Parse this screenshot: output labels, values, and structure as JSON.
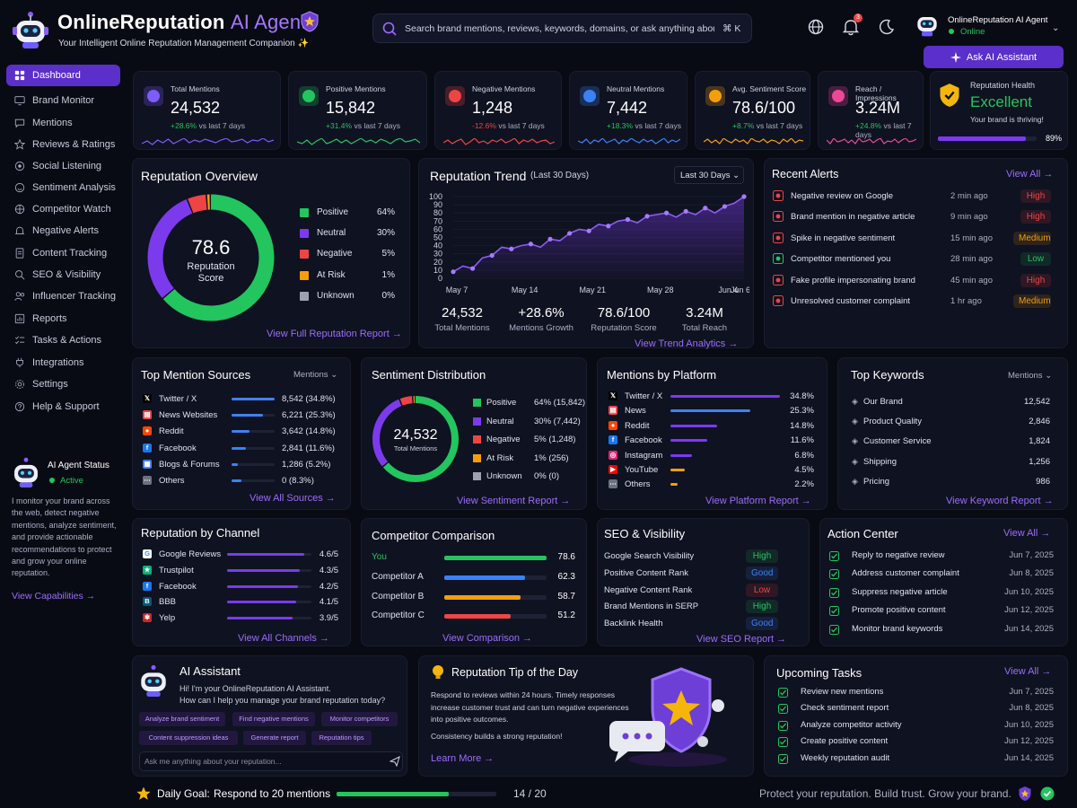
{
  "app": {
    "name": "OnlineReputation",
    "name_accent": "AI Agent",
    "subtitle": "Your Intelligent Online Reputation Management Companion ✨"
  },
  "search": {
    "placeholder": "Search brand mentions, reviews, keywords, domains, or ask anything about...",
    "shortcut": "⌘ K"
  },
  "header": {
    "notification_count": "3",
    "user_name": "OnlineReputation AI Agent",
    "user_status": "Online",
    "ask_button": "Ask AI Assistant"
  },
  "sidebar": {
    "items": [
      {
        "label": "Dashboard",
        "icon": "home-icon"
      },
      {
        "label": "Brand Monitor",
        "icon": "monitor-icon"
      },
      {
        "label": "Mentions",
        "icon": "chat-icon"
      },
      {
        "label": "Reviews & Ratings",
        "icon": "star-icon"
      },
      {
        "label": "Social Listening",
        "icon": "listen-icon"
      },
      {
        "label": "Sentiment Analysis",
        "icon": "sentiment-icon"
      },
      {
        "label": "Competitor Watch",
        "icon": "competitor-icon"
      },
      {
        "label": "Negative Alerts",
        "icon": "bell-icon"
      },
      {
        "label": "Content Tracking",
        "icon": "document-icon"
      },
      {
        "label": "SEO & Visibility",
        "icon": "seo-icon"
      },
      {
        "label": "Influencer Tracking",
        "icon": "influencer-icon"
      },
      {
        "label": "Reports",
        "icon": "report-icon"
      },
      {
        "label": "Tasks & Actions",
        "icon": "tasks-icon"
      },
      {
        "label": "Integrations",
        "icon": "plug-icon"
      },
      {
        "label": "Settings",
        "icon": "gear-icon"
      },
      {
        "label": "Help & Support",
        "icon": "help-icon"
      }
    ],
    "agent_status": {
      "title": "AI Agent Status",
      "status": "Active",
      "description": "I monitor your brand across the web, detect negative mentions, analyze sentiment, and provide actionable recommendations to protect and grow your online reputation.",
      "link": "View Capabilities →"
    }
  },
  "stats": [
    {
      "label": "Total Mentions",
      "value": "24,532",
      "change": "+28.6%",
      "suffix": "vs last 7 days",
      "color": "#7c5cff",
      "icon": "users-icon"
    },
    {
      "label": "Positive Mentions",
      "value": "15,842",
      "change": "+31.4%",
      "suffix": "vs last 7 days",
      "color": "#22c55e",
      "icon": "rocket-icon"
    },
    {
      "label": "Negative Mentions",
      "value": "1,248",
      "change": "-12.6%",
      "suffix": "vs last 7 days",
      "color": "#ef4444",
      "icon": "alert-shield-icon"
    },
    {
      "label": "Neutral Mentions",
      "value": "7,442",
      "change": "+18.3%",
      "suffix": "vs last 7 days",
      "color": "#3b82f6",
      "icon": "neutral-icon"
    },
    {
      "label": "Avg. Sentiment Score",
      "value": "78.6/100",
      "change": "+8.7%",
      "suffix": "vs last 7 days",
      "color": "#f59e0b",
      "icon": "shield-star-icon"
    },
    {
      "label": "Reach / Impressions",
      "value": "3.24M",
      "change": "+24.8%",
      "suffix": "vs last 7 days",
      "color": "#ec4899",
      "icon": "trend-icon"
    }
  ],
  "health": {
    "label": "Reputation Health",
    "value": "Excellent",
    "note": "Your brand is thriving!",
    "percent_text": "89%",
    "percent": 89
  },
  "overview": {
    "title": "Reputation Overview",
    "score": "78.6",
    "score_label": "Reputation Score",
    "legend": [
      {
        "label": "Positive",
        "value": "64%",
        "color": "#22c55e",
        "pct": 64
      },
      {
        "label": "Neutral",
        "value": "30%",
        "color": "#7c3aed",
        "pct": 30
      },
      {
        "label": "Negative",
        "value": "5%",
        "color": "#ef4444",
        "pct": 5
      },
      {
        "label": "At Risk",
        "value": "1%",
        "color": "#f59e0b",
        "pct": 1
      },
      {
        "label": "Unknown",
        "value": "0%",
        "color": "#9ca3af",
        "pct": 0
      }
    ],
    "link": "View Full Reputation Report →"
  },
  "trend": {
    "title": "Reputation Trend",
    "subtitle": "(Last 30 Days)",
    "range": "Last 30 Days",
    "stats": [
      {
        "value": "24,532",
        "label": "Total Mentions"
      },
      {
        "value": "+28.6%",
        "label": "Mentions Growth"
      },
      {
        "value": "78.6/100",
        "label": "Reputation Score"
      },
      {
        "value": "3.24M",
        "label": "Total Reach"
      }
    ],
    "link": "View Trend Analytics →"
  },
  "chart_data": {
    "type": "area",
    "x": [
      "May 7",
      "May 8",
      "May 9",
      "May 10",
      "May 11",
      "May 12",
      "May 13",
      "May 14",
      "May 15",
      "May 16",
      "May 17",
      "May 18",
      "May 19",
      "May 20",
      "May 21",
      "May 22",
      "May 23",
      "May 24",
      "May 25",
      "May 26",
      "May 27",
      "May 28",
      "May 29",
      "May 30",
      "May 31",
      "Jun 1",
      "Jun 2",
      "Jun 3",
      "Jun 4",
      "Jun 5",
      "Jun 6"
    ],
    "x_ticks": [
      "May 7",
      "May 14",
      "May 21",
      "May 28",
      "Jun 4",
      "Jun 6"
    ],
    "series": [
      {
        "values": [
          8,
          15,
          12,
          25,
          28,
          38,
          36,
          40,
          42,
          38,
          48,
          46,
          55,
          60,
          58,
          66,
          64,
          70,
          72,
          68,
          76,
          78,
          80,
          75,
          82,
          78,
          86,
          80,
          88,
          92,
          100
        ]
      }
    ],
    "ylim": [
      0,
      100
    ],
    "yticks": [
      0,
      10,
      20,
      30,
      40,
      50,
      60,
      70,
      80,
      90,
      100
    ],
    "grid": true
  },
  "alerts": {
    "title": "Recent Alerts",
    "link": "View All →",
    "items": [
      {
        "text": "Negative review on Google",
        "time": "2 min ago",
        "level": "High",
        "color": "#ef4444"
      },
      {
        "text": "Brand mention in negative article",
        "time": "9 min ago",
        "level": "High",
        "color": "#ef4444"
      },
      {
        "text": "Spike in negative sentiment",
        "time": "15 min ago",
        "level": "Medium",
        "color": "#f59e0b"
      },
      {
        "text": "Competitor mentioned you",
        "time": "28 min ago",
        "level": "Low",
        "color": "#22c55e"
      },
      {
        "text": "Fake profile impersonating brand",
        "time": "45 min ago",
        "level": "High",
        "color": "#ef4444"
      },
      {
        "text": "Unresolved customer complaint",
        "time": "1 hr ago",
        "level": "Medium",
        "color": "#f59e0b"
      }
    ]
  },
  "sources": {
    "title": "Top Mention Sources",
    "filter": "Mentions",
    "link": "View All Sources →",
    "items": [
      {
        "name": "Twitter / X",
        "value": "8,542 (34.8%)",
        "pct": 34.8,
        "icon": "twitter-icon"
      },
      {
        "name": "News Websites",
        "value": "6,221 (25.3%)",
        "pct": 25.3,
        "icon": "news-icon"
      },
      {
        "name": "Reddit",
        "value": "3,642 (14.8%)",
        "pct": 14.8,
        "icon": "reddit-icon"
      },
      {
        "name": "Facebook",
        "value": "2,841 (11.6%)",
        "pct": 11.6,
        "icon": "facebook-icon"
      },
      {
        "name": "Blogs & Forums",
        "value": "1,286 (5.2%)",
        "pct": 5.2,
        "icon": "blog-icon"
      },
      {
        "name": "Others",
        "value": "0 (8.3%)",
        "pct": 8.3,
        "icon": "others-icon"
      }
    ]
  },
  "sentiment": {
    "title": "Sentiment Distribution",
    "total": "24,532",
    "total_label": "Total Mentions",
    "link": "View Sentiment Report →",
    "items": [
      {
        "label": "Positive",
        "value": "64% (15,842)",
        "pct": 64,
        "color": "#22c55e"
      },
      {
        "label": "Neutral",
        "value": "30% (7,442)",
        "pct": 30,
        "color": "#7c3aed"
      },
      {
        "label": "Negative",
        "value": "5% (1,248)",
        "pct": 5,
        "color": "#ef4444"
      },
      {
        "label": "At Risk",
        "value": "1% (256)",
        "pct": 1,
        "color": "#f59e0b"
      },
      {
        "label": "Unknown",
        "value": "0% (0)",
        "pct": 0,
        "color": "#9ca3af"
      }
    ]
  },
  "platforms": {
    "title": "Mentions by Platform",
    "link": "View Platform Report →",
    "items": [
      {
        "name": "Twitter / X",
        "value": "34.8%",
        "pct": 34.8,
        "color": "#7c3aed",
        "icon": "twitter-icon"
      },
      {
        "name": "News",
        "value": "25.3%",
        "pct": 25.3,
        "color": "#3b82f6",
        "icon": "news-icon"
      },
      {
        "name": "Reddit",
        "value": "14.8%",
        "pct": 14.8,
        "color": "#7c3aed",
        "icon": "reddit-icon"
      },
      {
        "name": "Facebook",
        "value": "11.6%",
        "pct": 11.6,
        "color": "#7c3aed",
        "icon": "facebook-icon"
      },
      {
        "name": "Instagram",
        "value": "6.8%",
        "pct": 6.8,
        "color": "#7c3aed",
        "icon": "instagram-icon"
      },
      {
        "name": "YouTube",
        "value": "4.5%",
        "pct": 4.5,
        "color": "#f59e0b",
        "icon": "youtube-icon"
      },
      {
        "name": "Others",
        "value": "2.2%",
        "pct": 2.2,
        "color": "#f59e0b",
        "icon": "others-icon"
      }
    ]
  },
  "keywords": {
    "title": "Top Keywords",
    "filter": "Mentions",
    "link": "View Keyword Report →",
    "items": [
      {
        "name": "Our Brand",
        "value": "12,542"
      },
      {
        "name": "Product Quality",
        "value": "2,846"
      },
      {
        "name": "Customer Service",
        "value": "1,824"
      },
      {
        "name": "Shipping",
        "value": "1,256"
      },
      {
        "name": "Pricing",
        "value": "986"
      }
    ]
  },
  "channels": {
    "title": "Reputation by Channel",
    "link": "View All Channels →",
    "items": [
      {
        "name": "Google Reviews",
        "value": "4.6/5",
        "pct": 92,
        "icon": "google-icon"
      },
      {
        "name": "Trustpilot",
        "value": "4.3/5",
        "pct": 86,
        "icon": "trustpilot-icon"
      },
      {
        "name": "Facebook",
        "value": "4.2/5",
        "pct": 84,
        "icon": "facebook-icon"
      },
      {
        "name": "BBB",
        "value": "4.1/5",
        "pct": 82,
        "icon": "bbb-icon"
      },
      {
        "name": "Yelp",
        "value": "3.9/5",
        "pct": 78,
        "icon": "yelp-icon"
      }
    ]
  },
  "competitors": {
    "title": "Competitor Comparison",
    "link": "View Comparison →",
    "items": [
      {
        "name": "You",
        "value": "78.6",
        "pct": 78.6,
        "color": "#22c55e"
      },
      {
        "name": "Competitor A",
        "value": "62.3",
        "pct": 62.3,
        "color": "#3b82f6"
      },
      {
        "name": "Competitor B",
        "value": "58.7",
        "pct": 58.7,
        "color": "#f59e0b"
      },
      {
        "name": "Competitor C",
        "value": "51.2",
        "pct": 51.2,
        "color": "#ef4444"
      }
    ]
  },
  "seo": {
    "title": "SEO & Visibility",
    "link": "View SEO Report →",
    "items": [
      {
        "name": "Google Search Visibility",
        "status": "High",
        "color": "#22c55e"
      },
      {
        "name": "Positive Content Rank",
        "status": "Good",
        "color": "#3b82f6"
      },
      {
        "name": "Negative Content Rank",
        "status": "Low",
        "color": "#ef4444"
      },
      {
        "name": "Brand Mentions in SERP",
        "status": "High",
        "color": "#22c55e"
      },
      {
        "name": "Backlink Health",
        "status": "Good",
        "color": "#3b82f6"
      }
    ]
  },
  "action_center": {
    "title": "Action Center",
    "link": "View All →",
    "items": [
      {
        "name": "Reply to negative review",
        "date": "Jun 7, 2025"
      },
      {
        "name": "Address customer complaint",
        "date": "Jun 8, 2025"
      },
      {
        "name": "Suppress negative article",
        "date": "Jun 10, 2025"
      },
      {
        "name": "Promote positive content",
        "date": "Jun 12, 2025"
      },
      {
        "name": "Monitor brand keywords",
        "date": "Jun 14, 2025"
      }
    ]
  },
  "assistant": {
    "title": "AI Assistant",
    "greeting1": "Hi! I'm your OnlineReputation AI Assistant.",
    "greeting2": "How can I help you manage your brand reputation today?",
    "chips": [
      "Analyze brand sentiment",
      "Find negative mentions",
      "Monitor competitors",
      "Content suppression ideas",
      "Generate report",
      "Reputation tips"
    ],
    "input_placeholder": "Ask me anything about your reputation..."
  },
  "tip": {
    "title": "Reputation Tip of the Day",
    "text": "Respond to reviews within 24 hours. Timely responses increase customer trust and can turn negative experiences into positive outcomes.",
    "sub": "Consistency builds a strong reputation!",
    "link": "Learn More →"
  },
  "tasks": {
    "title": "Upcoming Tasks",
    "link": "View All →",
    "items": [
      {
        "name": "Review new mentions",
        "date": "Jun 7, 2025"
      },
      {
        "name": "Check sentiment report",
        "date": "Jun 8, 2025"
      },
      {
        "name": "Analyze competitor activity",
        "date": "Jun 10, 2025"
      },
      {
        "name": "Create positive content",
        "date": "Jun 12, 2025"
      },
      {
        "name": "Weekly reputation audit",
        "date": "Jun 14, 2025"
      }
    ]
  },
  "footer": {
    "goal_label": "Daily Goal:",
    "goal_text": "Respond to 20 mentions",
    "progress": "14 / 20",
    "progress_value": 0.7,
    "tagline": "Protect your reputation. Build trust. Grow your brand."
  }
}
